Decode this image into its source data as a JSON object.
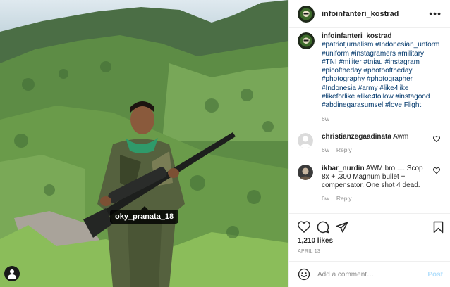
{
  "photo": {
    "tagged_user": "oky_pranata_18",
    "user_tag_icon": "person-icon"
  },
  "header": {
    "username": "infoinfanteri_kostrad",
    "more_icon": "ellipsis-icon",
    "more_label": "•••"
  },
  "caption": {
    "username": "infoinfanteri_kostrad",
    "text": "#patriotjurnalism #Indonesian_unform #uniform #instagramers #military #TNI #militer #tniau #instagram #picoftheday #photooftheday #photography #photographer #Indonesia #army #like4like #likeforlike #like4follow #instagood #abdinegarasumsel #love Flight",
    "age": "6w"
  },
  "comments": [
    {
      "username": "christianzegaadinata",
      "text": "Awm",
      "age": "6w",
      "reply_label": "Reply"
    },
    {
      "username": "ikbar_nurdin",
      "text": "AWM bro .... Scop 8x + .300 Magnum bullet + compensator. One shot 4 dead.",
      "age": "6w",
      "reply_label": "Reply"
    }
  ],
  "actions": {
    "icons": [
      "heart-icon",
      "comment-icon",
      "share-icon",
      "bookmark-icon"
    ]
  },
  "likes": "1,210 likes",
  "date": "APRIL 13",
  "add_comment": {
    "emoji_icon": "emoji-icon",
    "placeholder": "Add a comment…",
    "post_label": "Post"
  },
  "colors": {
    "hashtag": "#00376b",
    "muted": "#8e8e8e",
    "post_button": "#b2dffc",
    "border": "#efefef"
  }
}
